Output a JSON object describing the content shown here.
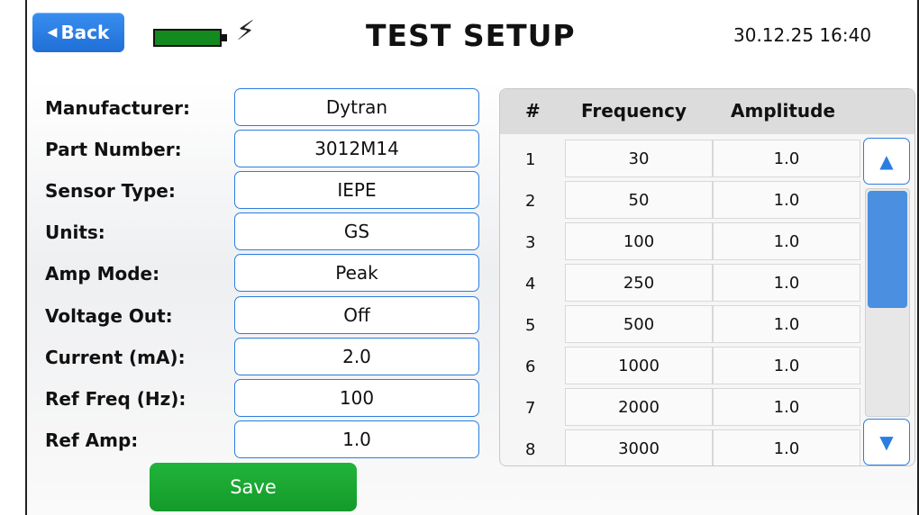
{
  "header": {
    "back_label": "Back",
    "title": "TEST SETUP",
    "datetime": "30.12.25 16:40",
    "battery_icon": "battery-icon",
    "charging_icon": "lightning-bolt-icon"
  },
  "form": {
    "manufacturer": {
      "label": "Manufacturer:",
      "value": "Dytran"
    },
    "part_number": {
      "label": "Part Number:",
      "value": "3012M14"
    },
    "sensor_type": {
      "label": "Sensor Type:",
      "value": "IEPE"
    },
    "units": {
      "label": "Units:",
      "value": "GS"
    },
    "amp_mode": {
      "label": "Amp Mode:",
      "value": "Peak"
    },
    "voltage_out": {
      "label": "Voltage Out:",
      "value": "Off"
    },
    "current": {
      "label": "Current (mA):",
      "value": "2.0"
    },
    "ref_freq": {
      "label": "Ref Freq (Hz):",
      "value": "100"
    },
    "ref_amp": {
      "label": "Ref Amp:",
      "value": "1.0"
    },
    "save_label": "Save"
  },
  "table": {
    "headers": {
      "num": "#",
      "frequency": "Frequency",
      "amplitude": "Amplitude"
    },
    "rows": [
      {
        "num": "1",
        "frequency": "30",
        "amplitude": "1.0"
      },
      {
        "num": "2",
        "frequency": "50",
        "amplitude": "1.0"
      },
      {
        "num": "3",
        "frequency": "100",
        "amplitude": "1.0"
      },
      {
        "num": "4",
        "frequency": "250",
        "amplitude": "1.0"
      },
      {
        "num": "5",
        "frequency": "500",
        "amplitude": "1.0"
      },
      {
        "num": "6",
        "frequency": "1000",
        "amplitude": "1.0"
      },
      {
        "num": "7",
        "frequency": "2000",
        "amplitude": "1.0"
      },
      {
        "num": "8",
        "frequency": "3000",
        "amplitude": "1.0"
      }
    ],
    "scroll_up_icon": "triangle-up-icon",
    "scroll_down_icon": "triangle-down-icon"
  },
  "colors": {
    "accent_blue": "#2a7de1",
    "save_green": "#1aa832",
    "battery_green": "#138a1e"
  }
}
